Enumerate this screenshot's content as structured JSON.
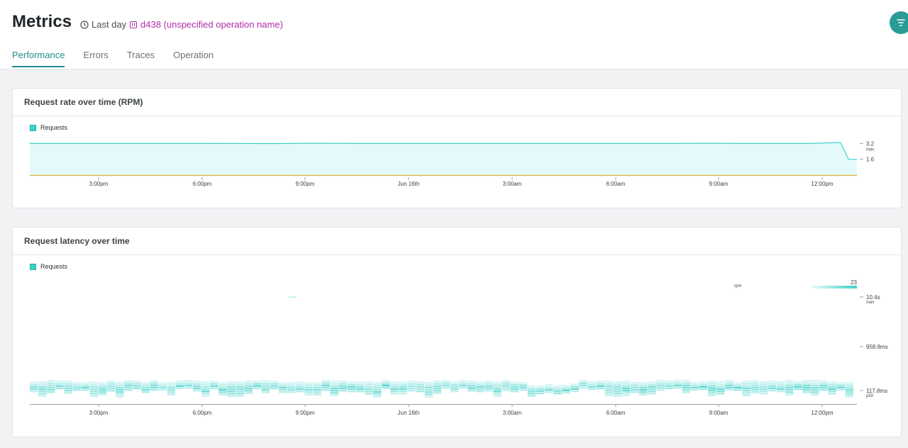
{
  "header": {
    "title": "Metrics",
    "time_range": "Last day",
    "operation_name": "d438 (unspecified operation name)"
  },
  "tabs": [
    {
      "label": "Performance",
      "active": true
    },
    {
      "label": "Errors",
      "active": false
    },
    {
      "label": "Traces",
      "active": false
    },
    {
      "label": "Operation",
      "active": false
    }
  ],
  "colors": {
    "accent": "#1e8e88",
    "series": "#3fd0c8",
    "area_fill": "#e4fafa",
    "operation": "#b12ea9",
    "baseline": "#e2b13c"
  },
  "icons": {
    "clock": "clock-icon",
    "operation": "operation-icon",
    "filter": "filter-icon"
  },
  "charts": {
    "rate": {
      "title": "Request rate over time (RPM)",
      "legend": "Requests"
    },
    "latency": {
      "title": "Request latency over time",
      "legend": "Requests",
      "density_legend_label": "rpm",
      "density_legend_max": "23"
    }
  },
  "chart_data": [
    {
      "type": "area",
      "title": "Request rate over time (RPM)",
      "series": [
        {
          "name": "Requests",
          "x": [
            "12:30pm",
            "2:00pm",
            "4:00pm",
            "6:00pm",
            "8:00pm",
            "9:00pm",
            "10:00pm",
            "Jun 16th",
            "2:00am",
            "4:00am",
            "6:00am",
            "8:00am",
            "9:00am",
            "10:00am",
            "12:00pm",
            "12:30pm",
            "12:50pm",
            "1:00pm"
          ],
          "values": [
            3.2,
            3.2,
            3.2,
            3.2,
            3.19,
            3.22,
            3.2,
            3.2,
            3.2,
            3.2,
            3.2,
            3.2,
            3.22,
            3.2,
            3.2,
            3.3,
            1.6,
            1.6
          ]
        }
      ],
      "xticks": [
        "3:00pm",
        "6:00pm",
        "9:00pm",
        "Jun 16th",
        "3:00am",
        "6:00am",
        "9:00am",
        "12:00pm"
      ],
      "yticks": [
        {
          "value": "3.2",
          "note": "max"
        },
        {
          "value": "1.6",
          "note": ""
        }
      ],
      "grid": false,
      "legend_position": "top-left"
    },
    {
      "type": "heatmap",
      "title": "Request latency over time",
      "series": [
        {
          "name": "Requests"
        }
      ],
      "xticks": [
        "3:00pm",
        "6:00pm",
        "9:00pm",
        "Jun 16th",
        "3:00am",
        "6:00am",
        "9:00am",
        "12:00pm"
      ],
      "yticks": [
        {
          "value": "10.4s",
          "note": "max"
        },
        {
          "value": "958.8ms",
          "note": ""
        },
        {
          "value": "117.8ms",
          "note": "p50"
        }
      ],
      "color_scale": {
        "label": "rpm",
        "max": 23
      },
      "y_scale": "log",
      "grid": false,
      "legend_position": "top-left"
    }
  ]
}
